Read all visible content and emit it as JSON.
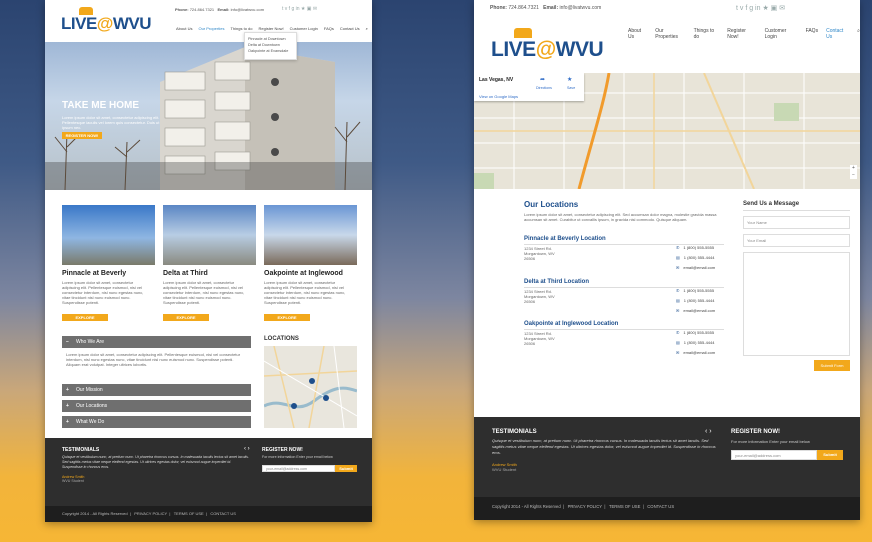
{
  "site": {
    "logo_text": "LIVE",
    "logo_at": "@",
    "logo_wvu": "WVU",
    "phone_label": "Phone:",
    "phone": "724.864.7321",
    "email_label": "Email:",
    "email": "info@livatwvu.com",
    "social_icons": "t  v  f  g  in  ★  ▣  ✉",
    "nav": [
      "About Us",
      "Our Properties",
      "Things to do",
      "Register Now!",
      "Customer Login",
      "FAQs",
      "Contact Us"
    ],
    "dropdown": [
      "Pinnacle at Downtown",
      "Delta at Downtown",
      "Oakpointe at Evansdale"
    ]
  },
  "home": {
    "hero_title": "TAKE ME HOME",
    "hero_text": "Lorem ipsum dolor sit amet, consectetur adipiscing elit. Pellentesque iaculis vel lorem quis consectetur. Duis ut ipsum nec.",
    "hero_button": "REGISTER NOW!",
    "properties": [
      {
        "title": "Pinnacle at Beverly",
        "text": "Lorem ipsum dolor sit amet, consectetur adipiscing elit. Pellentesque euismod, nisi vel consectetur interdum, nisl nunc egestas nunc, vitae tincidunt nisl nunc euismod nunc. Suspendisse potenti.",
        "button": "EXPLORE"
      },
      {
        "title": "Delta at Third",
        "text": "Lorem ipsum dolor sit amet, consectetur adipiscing elit. Pellentesque euismod, nisi vel consectetur interdum, nisl nunc egestas nunc, vitae tincidunt nisl nunc euismod nunc. Suspendisse potenti.",
        "button": "EXPLORE"
      },
      {
        "title": "Oakpointe at Inglewood",
        "text": "Lorem ipsum dolor sit amet, consectetur adipiscing elit. Pellentesque euismod, nisi vel consectetur interdum, nisl nunc egestas nunc, vitae tincidunt nisl nunc euismod nunc. Suspendisse potenti.",
        "button": "EXPLORE"
      }
    ],
    "accordion": [
      {
        "sign": "−",
        "label": "Who We Are"
      },
      {
        "sign": "+",
        "label": "Our Mission"
      },
      {
        "sign": "+",
        "label": "Our Locations"
      },
      {
        "sign": "+",
        "label": "What We Do"
      }
    ],
    "accordion_text": "Lorem ipsum dolor sit amet, consectetur adipiscing elit. Pellentesque euismod, nisi vel consectetur interdum, nisl nunc egestas nunc, vitae tincidunt nisl nunc euismod nunc. Suspendisse potenti. Aliquam erat volutpat. Integer ultrices lobortis.",
    "locations_title": "LOCATIONS"
  },
  "footer": {
    "testimonials_title": "TESTIMONIALS",
    "testimonial_text": "Quisque et vestibulum nunc, at pretium nunc. Ut pharetra rhoncus cursus. In malesuada iaculis lectus sit amet iaculis. Sed sagittis metus vitae neque eleifend egestas. Ut ultrices egestas dolor, vel euismod augue imperdiet id. Suspendisse in rhoncus eros.",
    "author": "Andrew Smith",
    "author_role": "WVU Student",
    "prev": "‹",
    "next": "›",
    "register_title": "REGISTER NOW!",
    "register_text": "For more information Enter your email below",
    "email_placeholder": "your-email@address.com",
    "submit": "Submit",
    "copyright": "Copyright 2014 - All Rights Reserved",
    "privacy": "PRIVACY POLICY",
    "terms": "TERMS OF USE",
    "contact": "CONTACT US"
  },
  "contact": {
    "map_place": "Las Vegas, NV",
    "map_link": "View on Google Maps",
    "directions": "Directions",
    "save": "Save",
    "our_locations": "Our Locations",
    "intro": "Lorem ipsum dolor sit amet, consectetur adipiscing elit. Sed accumsan dolor magna, molestie gravida massa accumsan sit amet. Curabitur ut convallis ipsum, in gravida nisl commodo. Quisque aliquam.",
    "locations": [
      {
        "name": "Pinnacle at Beverly Location",
        "addr1": "1234 Street Rd.",
        "addr2": "Morgantown, WV",
        "zip": "26506",
        "phone": "1 (800) 555-5555",
        "fax": "1 (800) 555-4444",
        "email": "email@email.com"
      },
      {
        "name": "Delta at Third Location",
        "addr1": "1234 Street Rd.",
        "addr2": "Morgantown, WV",
        "zip": "26506",
        "phone": "1 (800) 555-5555",
        "fax": "1 (800) 555-4444",
        "email": "email@email.com"
      },
      {
        "name": "Oakpointe at Inglewood Location",
        "addr1": "1234 Street Rd.",
        "addr2": "Morgantown, WV",
        "zip": "26506",
        "phone": "1 (800) 555-5555",
        "fax": "1 (800) 555-4444",
        "email": "email@email.com"
      }
    ],
    "send_title": "Send Us a Message",
    "name_placeholder": "Your Name",
    "email_placeholder": "Your Email",
    "submit": "Submit Form"
  }
}
